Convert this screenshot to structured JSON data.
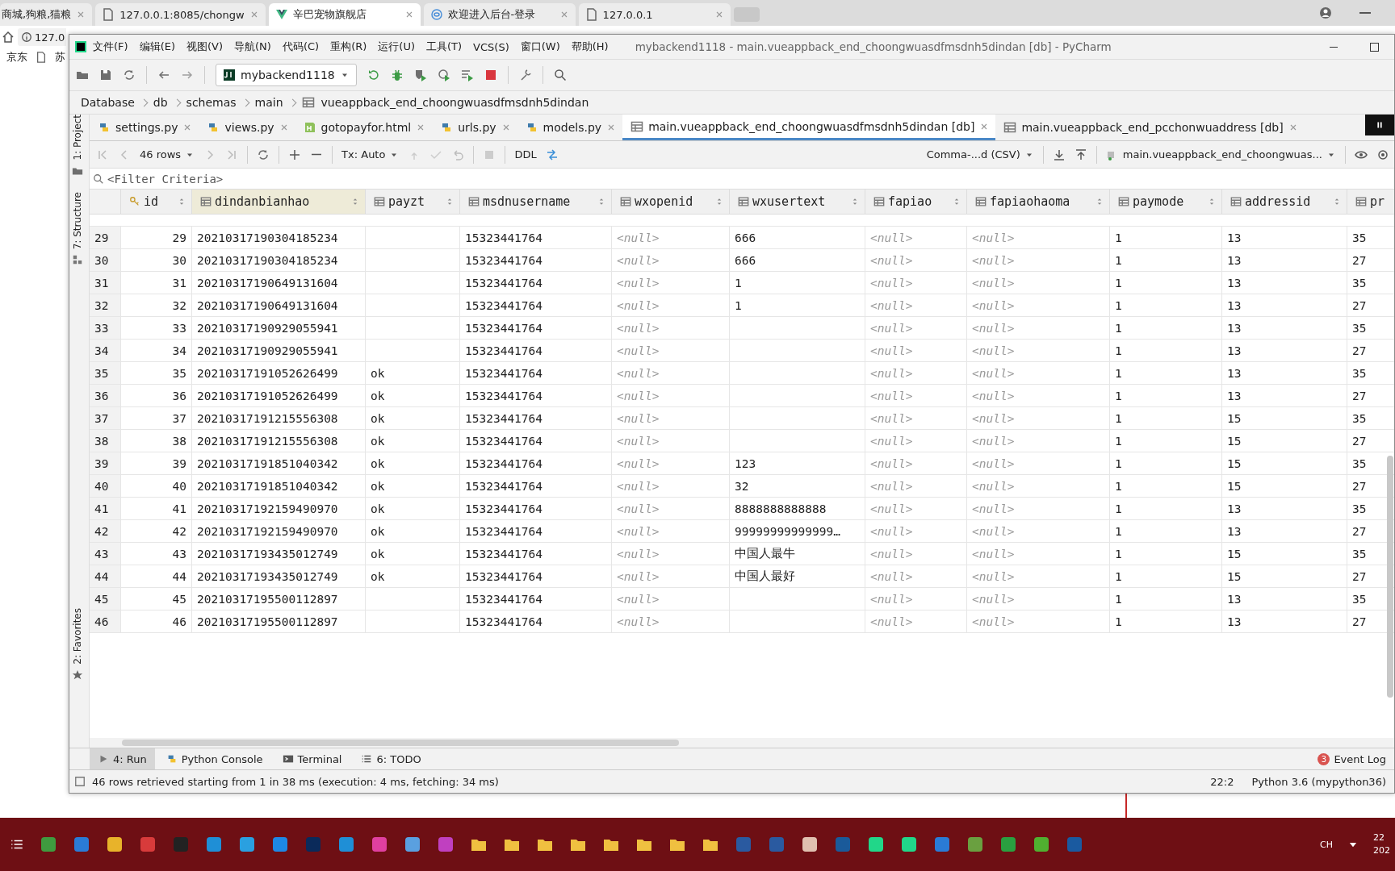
{
  "browser": {
    "tabs": [
      {
        "title": "商城,狗粮,猫粮",
        "selected": false
      },
      {
        "title": "127.0.0.1:8085/chongw",
        "kind": "page",
        "selected": false
      },
      {
        "title": "辛巴宠物旗舰店",
        "kind": "vue",
        "selected": true
      },
      {
        "title": "欢迎进入后台-登录",
        "kind": "globe",
        "selected": false
      },
      {
        "title": "127.0.0.1",
        "kind": "page",
        "selected": false
      }
    ],
    "address": "127.0",
    "bookmarks": [
      {
        "label": "京东",
        "kind": "text"
      },
      {
        "label": "苏",
        "kind": "doc"
      }
    ]
  },
  "ide": {
    "menu": [
      "文件(F)",
      "编辑(E)",
      "视图(V)",
      "导航(N)",
      "代码(C)",
      "重构(R)",
      "运行(U)",
      "工具(T)",
      "VCS(S)",
      "窗口(W)",
      "帮助(H)"
    ],
    "title": "mybackend1118 - main.vueappback_end_choongwuasdfmsdnh5dindan [db] - PyCharm",
    "run_config": "mybackend1118",
    "breadcrumb": [
      "Database",
      "db",
      "schemas",
      "main",
      "vueappback_end_choongwuasdfmsdnh5dindan"
    ],
    "side_tools": [
      {
        "label": "1: Project",
        "kind": "folder"
      },
      {
        "label": "7: Structure",
        "kind": "structure"
      },
      {
        "label": "2: Favorites",
        "kind": "star"
      }
    ],
    "editor_tabs": [
      {
        "label": "settings.py",
        "kind": "python",
        "selected": false
      },
      {
        "label": "views.py",
        "kind": "python",
        "selected": false
      },
      {
        "label": "gotopayfor.html",
        "kind": "html",
        "selected": false
      },
      {
        "label": "urls.py",
        "kind": "python",
        "selected": false
      },
      {
        "label": "models.py",
        "kind": "python",
        "selected": false
      },
      {
        "label": "main.vueappback_end_choongwuasdfmsdnh5dindan [db]",
        "kind": "table",
        "selected": true
      },
      {
        "label": "main.vueappback_end_pcchonwuaddress [db]",
        "kind": "table",
        "selected": false
      }
    ],
    "grid_toolbar": {
      "rows": "46 rows",
      "tx": "Tx: Auto",
      "ddl": "DDL",
      "export": "Comma-...d (CSV)",
      "target": "main.vueappback_end_choongwuas..."
    },
    "filter": {
      "placeholder": "<Filter Criteria>"
    },
    "table": {
      "columns": [
        {
          "name": "id",
          "primary_key": true
        },
        {
          "name": "dindanbianhao"
        },
        {
          "name": "payzt"
        },
        {
          "name": "msdnusername"
        },
        {
          "name": "wxopenid"
        },
        {
          "name": "wxusertext"
        },
        {
          "name": "fapiao"
        },
        {
          "name": "fapiaohaoma"
        },
        {
          "name": "paymode"
        },
        {
          "name": "addressid"
        },
        {
          "name": "pr"
        }
      ],
      "rows": [
        {
          "number": "29",
          "cells": [
            "29",
            "20210317190304185234",
            null,
            "15323441764",
            {
              "kind": "null",
              "text": "<null>"
            },
            "666",
            {
              "kind": "null",
              "text": "<null>"
            },
            {
              "kind": "null",
              "text": "<null>"
            },
            "1",
            "13",
            "35"
          ]
        },
        {
          "number": "30",
          "cells": [
            "30",
            "20210317190304185234",
            null,
            "15323441764",
            {
              "kind": "null",
              "text": "<null>"
            },
            "666",
            {
              "kind": "null",
              "text": "<null>"
            },
            {
              "kind": "null",
              "text": "<null>"
            },
            "1",
            "13",
            "27"
          ]
        },
        {
          "number": "31",
          "cells": [
            "31",
            "20210317190649131604",
            null,
            "15323441764",
            {
              "kind": "null",
              "text": "<null>"
            },
            "1",
            {
              "kind": "null",
              "text": "<null>"
            },
            {
              "kind": "null",
              "text": "<null>"
            },
            "1",
            "13",
            "35"
          ]
        },
        {
          "number": "32",
          "cells": [
            "32",
            "20210317190649131604",
            null,
            "15323441764",
            {
              "kind": "null",
              "text": "<null>"
            },
            "1",
            {
              "kind": "null",
              "text": "<null>"
            },
            {
              "kind": "null",
              "text": "<null>"
            },
            "1",
            "13",
            "27"
          ]
        },
        {
          "number": "33",
          "cells": [
            "33",
            "20210317190929055941",
            null,
            "15323441764",
            {
              "kind": "null",
              "text": "<null>"
            },
            null,
            {
              "kind": "null",
              "text": "<null>"
            },
            {
              "kind": "null",
              "text": "<null>"
            },
            "1",
            "13",
            "35"
          ]
        },
        {
          "number": "34",
          "cells": [
            "34",
            "20210317190929055941",
            null,
            "15323441764",
            {
              "kind": "null",
              "text": "<null>"
            },
            null,
            {
              "kind": "null",
              "text": "<null>"
            },
            {
              "kind": "null",
              "text": "<null>"
            },
            "1",
            "13",
            "27"
          ]
        },
        {
          "number": "35",
          "cells": [
            "35",
            "20210317191052626499",
            "ok",
            "15323441764",
            {
              "kind": "null",
              "text": "<null>"
            },
            null,
            {
              "kind": "null",
              "text": "<null>"
            },
            {
              "kind": "null",
              "text": "<null>"
            },
            "1",
            "13",
            "35"
          ]
        },
        {
          "number": "36",
          "cells": [
            "36",
            "20210317191052626499",
            "ok",
            "15323441764",
            {
              "kind": "null",
              "text": "<null>"
            },
            null,
            {
              "kind": "null",
              "text": "<null>"
            },
            {
              "kind": "null",
              "text": "<null>"
            },
            "1",
            "13",
            "27"
          ]
        },
        {
          "number": "37",
          "cells": [
            "37",
            "20210317191215556308",
            "ok",
            "15323441764",
            {
              "kind": "null",
              "text": "<null>"
            },
            null,
            {
              "kind": "null",
              "text": "<null>"
            },
            {
              "kind": "null",
              "text": "<null>"
            },
            "1",
            "15",
            "35"
          ]
        },
        {
          "number": "38",
          "cells": [
            "38",
            "20210317191215556308",
            "ok",
            "15323441764",
            {
              "kind": "null",
              "text": "<null>"
            },
            null,
            {
              "kind": "null",
              "text": "<null>"
            },
            {
              "kind": "null",
              "text": "<null>"
            },
            "1",
            "15",
            "27"
          ]
        },
        {
          "number": "39",
          "cells": [
            "39",
            "20210317191851040342",
            "ok",
            "15323441764",
            {
              "kind": "null",
              "text": "<null>"
            },
            "123",
            {
              "kind": "null",
              "text": "<null>"
            },
            {
              "kind": "null",
              "text": "<null>"
            },
            "1",
            "15",
            "35"
          ]
        },
        {
          "number": "40",
          "cells": [
            "40",
            "20210317191851040342",
            "ok",
            "15323441764",
            {
              "kind": "null",
              "text": "<null>"
            },
            "32",
            {
              "kind": "null",
              "text": "<null>"
            },
            {
              "kind": "null",
              "text": "<null>"
            },
            "1",
            "15",
            "27"
          ]
        },
        {
          "number": "41",
          "cells": [
            "41",
            "20210317192159490970",
            "ok",
            "15323441764",
            {
              "kind": "null",
              "text": "<null>"
            },
            "8888888888888",
            {
              "kind": "null",
              "text": "<null>"
            },
            {
              "kind": "null",
              "text": "<null>"
            },
            "1",
            "13",
            "35"
          ]
        },
        {
          "number": "42",
          "cells": [
            "42",
            "20210317192159490970",
            "ok",
            "15323441764",
            {
              "kind": "null",
              "text": "<null>"
            },
            "99999999999999…",
            {
              "kind": "null",
              "text": "<null>"
            },
            {
              "kind": "null",
              "text": "<null>"
            },
            "1",
            "13",
            "27"
          ]
        },
        {
          "number": "43",
          "cells": [
            "43",
            "20210317193435012749",
            "ok",
            "15323441764",
            {
              "kind": "null",
              "text": "<null>"
            },
            "中国人最牛",
            {
              "kind": "null",
              "text": "<null>"
            },
            {
              "kind": "null",
              "text": "<null>"
            },
            "1",
            "15",
            "35"
          ]
        },
        {
          "number": "44",
          "cells": [
            "44",
            "20210317193435012749",
            "ok",
            "15323441764",
            {
              "kind": "null",
              "text": "<null>"
            },
            "中国人最好",
            {
              "kind": "null",
              "text": "<null>"
            },
            {
              "kind": "null",
              "text": "<null>"
            },
            "1",
            "15",
            "27"
          ]
        },
        {
          "number": "45",
          "cells": [
            "45",
            "20210317195500112897",
            null,
            "15323441764",
            {
              "kind": "null",
              "text": "<null>"
            },
            null,
            {
              "kind": "null",
              "text": "<null>"
            },
            {
              "kind": "null",
              "text": "<null>"
            },
            "1",
            "13",
            "35"
          ]
        },
        {
          "number": "46",
          "cells": [
            "46",
            "20210317195500112897",
            null,
            "15323441764",
            {
              "kind": "null",
              "text": "<null>"
            },
            null,
            {
              "kind": "null",
              "text": "<null>"
            },
            {
              "kind": "null",
              "text": "<null>"
            },
            "1",
            "13",
            "27"
          ]
        }
      ]
    },
    "tool_tabs": [
      {
        "label": "4: Run",
        "kind": "run",
        "selected": true
      },
      {
        "label": "Python Console",
        "kind": "python",
        "selected": false
      },
      {
        "label": "Terminal",
        "kind": "terminal",
        "selected": false
      },
      {
        "label": "6: TODO",
        "kind": "todo",
        "selected": false
      }
    ],
    "event_log": {
      "count": "3",
      "label": "Event Log"
    },
    "status": {
      "message": "46 rows retrieved starting from 1 in 38 ms (execution: 4 ms, fetching: 34 ms)",
      "position": "22:2",
      "interpreter": "Python 3.6 (mypython36)"
    }
  },
  "taskbar": {
    "language": "CH",
    "clock": [
      "22",
      "202"
    ]
  }
}
